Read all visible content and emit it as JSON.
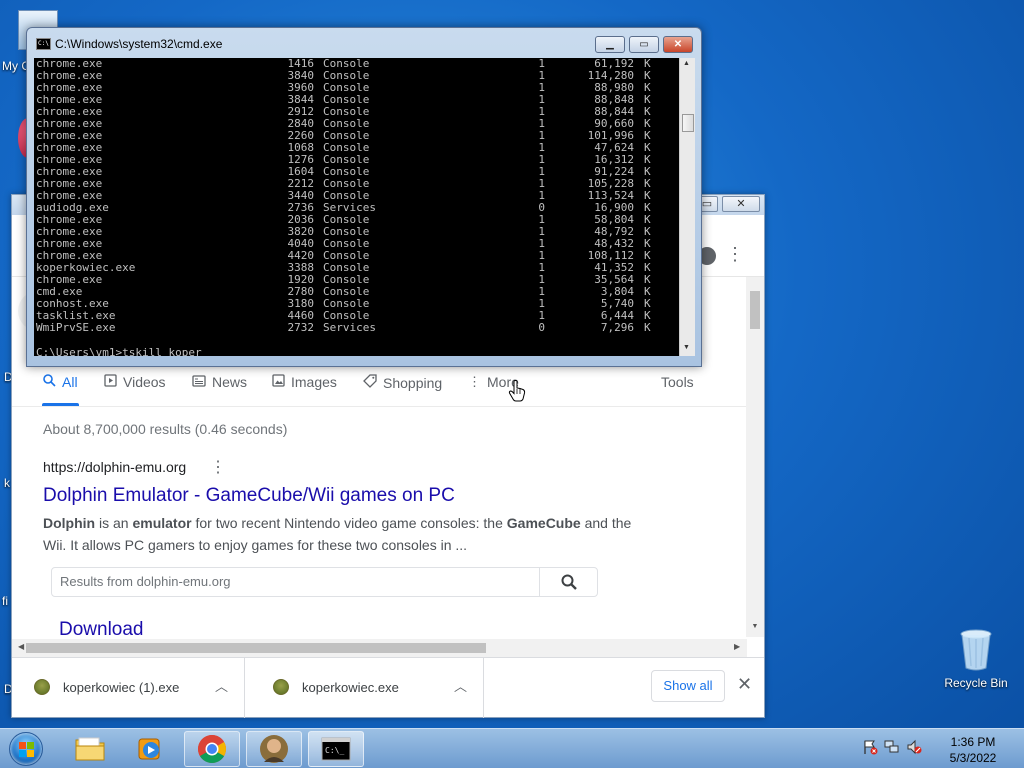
{
  "desktop": {
    "recycle_bin_label": "Recycle Bin",
    "left_stubs": [
      "My C",
      "D",
      "k",
      "fi",
      "D"
    ]
  },
  "cmd": {
    "title": "C:\\Windows\\system32\\cmd.exe",
    "rows": [
      [
        "chrome.exe",
        "1416",
        "Console",
        "1",
        "61,192",
        "K"
      ],
      [
        "chrome.exe",
        "3840",
        "Console",
        "1",
        "114,280",
        "K"
      ],
      [
        "chrome.exe",
        "3960",
        "Console",
        "1",
        "88,980",
        "K"
      ],
      [
        "chrome.exe",
        "3844",
        "Console",
        "1",
        "88,848",
        "K"
      ],
      [
        "chrome.exe",
        "2912",
        "Console",
        "1",
        "88,844",
        "K"
      ],
      [
        "chrome.exe",
        "2840",
        "Console",
        "1",
        "90,660",
        "K"
      ],
      [
        "chrome.exe",
        "2260",
        "Console",
        "1",
        "101,996",
        "K"
      ],
      [
        "chrome.exe",
        "1068",
        "Console",
        "1",
        "47,624",
        "K"
      ],
      [
        "chrome.exe",
        "1276",
        "Console",
        "1",
        "16,312",
        "K"
      ],
      [
        "chrome.exe",
        "1604",
        "Console",
        "1",
        "91,224",
        "K"
      ],
      [
        "chrome.exe",
        "2212",
        "Console",
        "1",
        "105,228",
        "K"
      ],
      [
        "chrome.exe",
        "3440",
        "Console",
        "1",
        "113,524",
        "K"
      ],
      [
        "audiodg.exe",
        "2736",
        "Services",
        "0",
        "16,900",
        "K"
      ],
      [
        "chrome.exe",
        "2036",
        "Console",
        "1",
        "58,804",
        "K"
      ],
      [
        "chrome.exe",
        "3820",
        "Console",
        "1",
        "48,792",
        "K"
      ],
      [
        "chrome.exe",
        "4040",
        "Console",
        "1",
        "48,432",
        "K"
      ],
      [
        "chrome.exe",
        "4420",
        "Console",
        "1",
        "108,112",
        "K"
      ],
      [
        "koperkowiec.exe",
        "3388",
        "Console",
        "1",
        "41,352",
        "K"
      ],
      [
        "chrome.exe",
        "1920",
        "Console",
        "1",
        "35,564",
        "K"
      ],
      [
        "cmd.exe",
        "2780",
        "Console",
        "1",
        "3,804",
        "K"
      ],
      [
        "conhost.exe",
        "3180",
        "Console",
        "1",
        "5,740",
        "K"
      ],
      [
        "tasklist.exe",
        "4460",
        "Console",
        "1",
        "6,444",
        "K"
      ],
      [
        "WmiPrvSE.exe",
        "2732",
        "Services",
        "0",
        "7,296",
        "K"
      ]
    ],
    "prompt": "C:\\Users\\vm1>tskill koper"
  },
  "chrome": {
    "tabs": [
      {
        "label": "All",
        "icon": "search-icon"
      },
      {
        "label": "Videos",
        "icon": "video-icon"
      },
      {
        "label": "News",
        "icon": "news-icon"
      },
      {
        "label": "Images",
        "icon": "image-icon"
      },
      {
        "label": "Shopping",
        "icon": "tag-icon"
      },
      {
        "label": "More",
        "icon": "more-vertical-icon"
      }
    ],
    "tools_label": "Tools",
    "result_stats": "About 8,700,000 results (0.46 seconds)",
    "result": {
      "url": "https://dolphin-emu.org",
      "title": "Dolphin Emulator - GameCube/Wii games on PC",
      "snippet_b1": "Dolphin",
      "snippet_t1": " is an ",
      "snippet_b2": "emulator",
      "snippet_t2": " for two recent Nintendo video game consoles: the ",
      "snippet_b3": "GameCube",
      "snippet_t3": " and the Wii. It allows PC gamers to enjoy games for these two consoles in ...",
      "site_search_placeholder": "Results from dolphin-emu.org",
      "sitelink": "Download"
    },
    "downloads": {
      "items": [
        "koperkowiec (1).exe",
        "koperkowiec.exe"
      ],
      "show_all": "Show all"
    }
  },
  "taskbar": {
    "time": "1:36 PM",
    "date": "5/3/2022"
  },
  "colors": {
    "link": "#1a0dab",
    "accent": "#1a73e8",
    "desktop": "#1468c6"
  }
}
